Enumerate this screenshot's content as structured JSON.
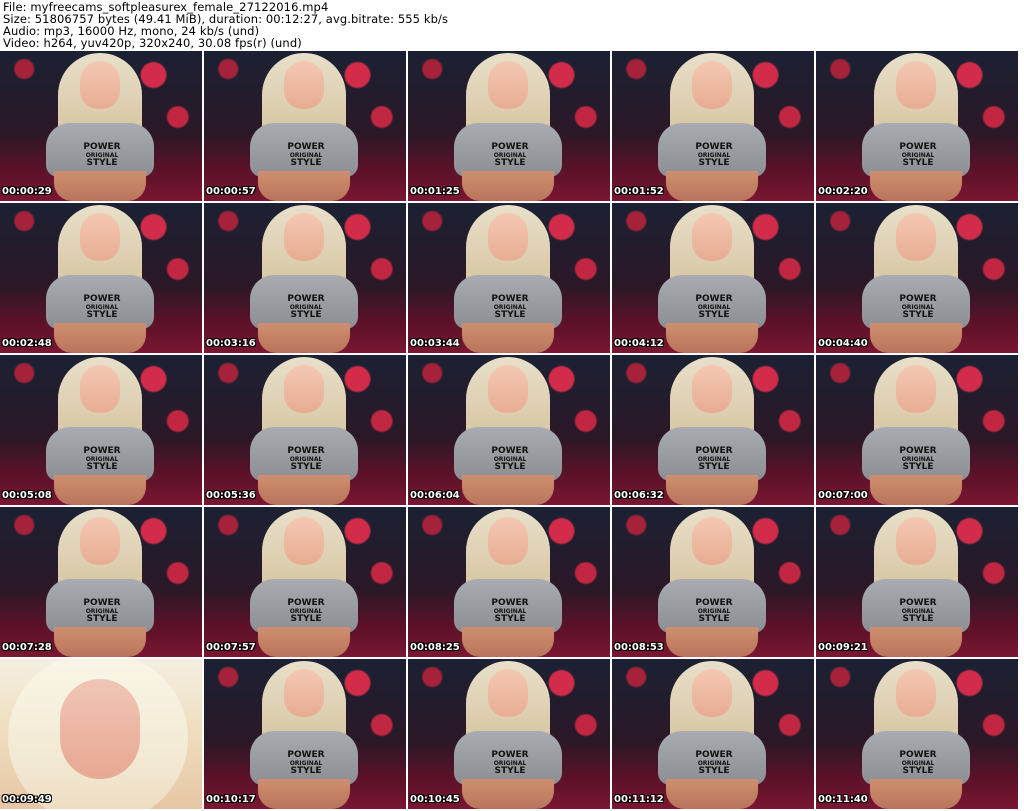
{
  "header": {
    "file": "File: myfreecams_softpleasurex_female_27122016.mp4",
    "size": "Size: 51806757 bytes (49.41 MiB), duration: 00:12:27, avg.bitrate: 555 kb/s",
    "audio": "Audio: mp3, 16000 Hz, mono, 24 kb/s (und)",
    "video": "Video: h264, yuv420p, 320x240, 30.08 fps(r) (und)"
  },
  "thumbnails": [
    {
      "time": "00:00:29"
    },
    {
      "time": "00:00:57"
    },
    {
      "time": "00:01:25"
    },
    {
      "time": "00:01:52"
    },
    {
      "time": "00:02:20"
    },
    {
      "time": "00:02:48"
    },
    {
      "time": "00:03:16"
    },
    {
      "time": "00:03:44"
    },
    {
      "time": "00:04:12"
    },
    {
      "time": "00:04:40"
    },
    {
      "time": "00:05:08"
    },
    {
      "time": "00:05:36"
    },
    {
      "time": "00:06:04"
    },
    {
      "time": "00:06:32"
    },
    {
      "time": "00:07:00"
    },
    {
      "time": "00:07:28"
    },
    {
      "time": "00:07:57"
    },
    {
      "time": "00:08:25"
    },
    {
      "time": "00:08:53"
    },
    {
      "time": "00:09:21"
    },
    {
      "time": "00:09:49"
    },
    {
      "time": "00:10:17"
    },
    {
      "time": "00:10:45"
    },
    {
      "time": "00:11:12"
    },
    {
      "time": "00:11:40"
    }
  ],
  "shirt_print": {
    "line1": "POWER",
    "line2": "ORIGINAL",
    "line3": "STYLE"
  },
  "colors": {
    "background": "#ffffff",
    "timestamp_text": "#ffffff",
    "timestamp_outline": "#000000",
    "header_text": "#000000"
  }
}
